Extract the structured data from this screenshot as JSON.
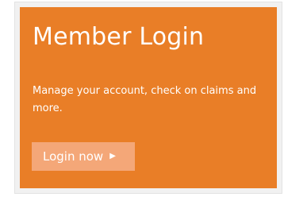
{
  "card": {
    "title": "Member Login",
    "description": "Manage your account, check on claims and more.",
    "button_label": "Login now",
    "button_icon": "triangle-right-icon",
    "button_icon_glyph": "▶"
  },
  "colors": {
    "card_background": "#e97e27",
    "button_background": "#f4a778",
    "text": "#ffffff",
    "frame_background": "#f1f1f1"
  }
}
